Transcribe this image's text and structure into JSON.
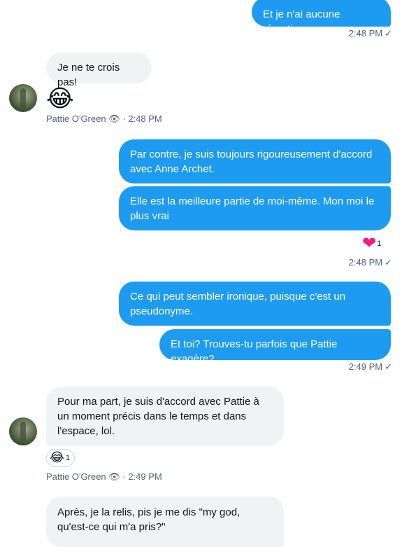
{
  "messages": [
    {
      "text": "Et je n'ai aucune répartie."
    },
    {
      "time": "2:48 PM",
      "check": "✓"
    },
    {
      "text": "Je ne te crois pas!"
    },
    {
      "emoji": "😂"
    },
    {
      "sender": "Pattie O'Green",
      "eye": "👁",
      "sep": "·",
      "time": "2:48 PM"
    },
    {
      "text": "Par contre, je suis toujours rigoureusement d'accord avec Anne Archet."
    },
    {
      "text": "Elle est la meilleure partie de moi-même. Mon moi le plus vrai"
    },
    {
      "reaction": "❤",
      "count": "1"
    },
    {
      "time": "2:48 PM",
      "check": "✓"
    },
    {
      "text": "Ce qui peut sembler ironique, puisque c'est un pseudonyme."
    },
    {
      "text": "Et toi? Trouves-tu parfois que Pattie exagère?"
    },
    {
      "time": "2:49 PM",
      "check": "✓"
    },
    {
      "text": "Pour ma part, je suis d'accord avec Pattie à un moment précis dans le temps et dans l'espace, lol."
    },
    {
      "reaction": "😂",
      "count": "1"
    },
    {
      "sender": "Pattie O'Green",
      "eye": "👁",
      "sep": "·",
      "time": "2:49 PM"
    },
    {
      "text": "Après, je la relis, pis je me dis \"my god, qu'est-ce qui m'a pris?\""
    }
  ],
  "colors": {
    "outgoing": "#1d9bf0",
    "incoming": "#eff3f4",
    "heart": "#f91880"
  }
}
